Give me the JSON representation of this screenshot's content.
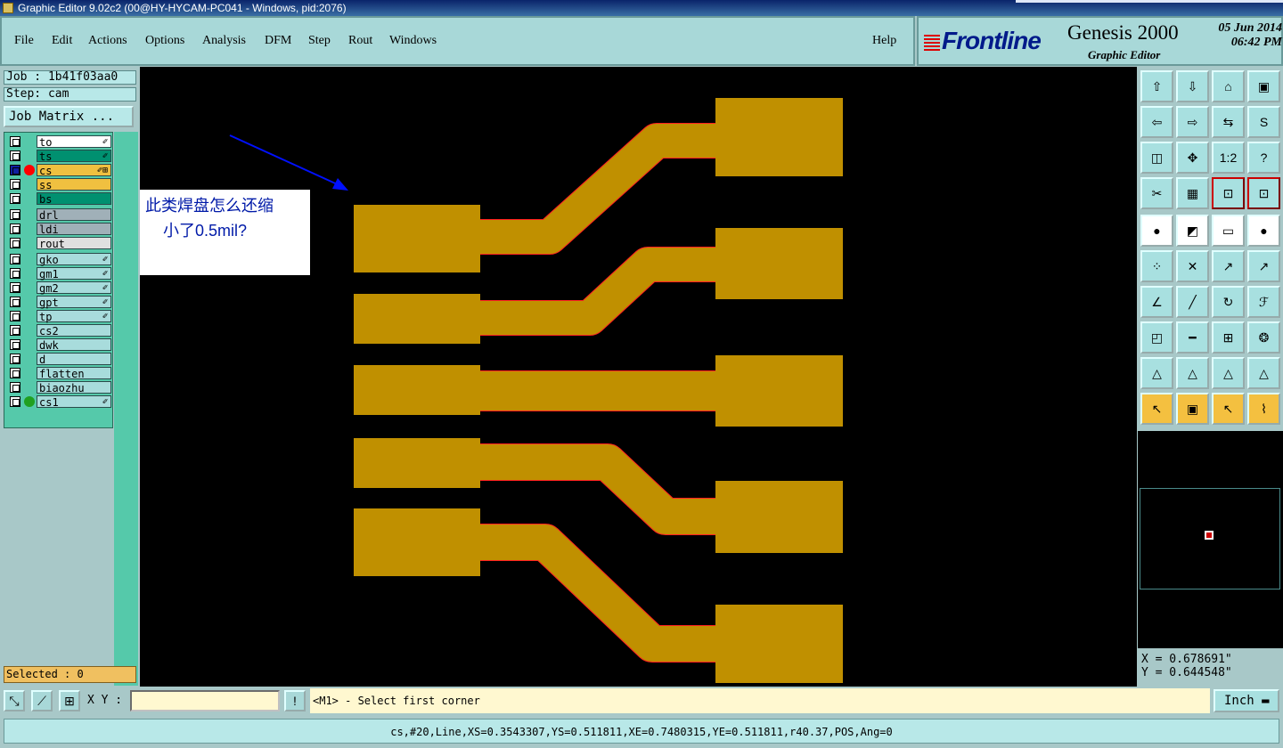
{
  "window": {
    "title": "Graphic Editor 9.02c2 (00@HY-HYCAM-PC041 - Windows, pid:2076)"
  },
  "menu": {
    "items": [
      "File",
      "Edit",
      "Actions",
      "Options",
      "Analysis",
      "DFM",
      "Step",
      "Rout",
      "Windows"
    ],
    "help": "Help"
  },
  "brand": {
    "logo": "Frontline",
    "product": "Genesis 2000",
    "subtitle": "Graphic Editor",
    "date": "05 Jun 2014",
    "time": "06:42 PM"
  },
  "job": {
    "job_label": "Job : 1b41f03aa0",
    "step_label": "Step: cam",
    "matrix_button": "Job Matrix ..."
  },
  "layers": [
    {
      "name": "to",
      "color": "#ffffff",
      "dot": "",
      "mark": "✐"
    },
    {
      "name": "ts",
      "color": "#009070",
      "dot": "",
      "mark": "✐"
    },
    {
      "name": "cs",
      "color": "#f0c040",
      "dot": "#ff0000",
      "mark": "✐⊞",
      "active": true
    },
    {
      "name": "ss",
      "color": "#f0c040",
      "dot": "",
      "mark": ""
    },
    {
      "name": "bs",
      "color": "#009070",
      "dot": "",
      "mark": ""
    },
    {
      "name": "drl",
      "color": "#a0b0b8",
      "dot": "",
      "mark": ""
    },
    {
      "name": "ldi",
      "color": "#a0b0b8",
      "dot": "",
      "mark": ""
    },
    {
      "name": "rout",
      "color": "#e0e0e0",
      "dot": "",
      "mark": ""
    },
    {
      "name": "gko",
      "color": "#a8dcdc",
      "dot": "",
      "mark": "✐"
    },
    {
      "name": "gm1",
      "color": "#a8dcdc",
      "dot": "",
      "mark": "✐"
    },
    {
      "name": "gm2",
      "color": "#a8dcdc",
      "dot": "",
      "mark": "✐"
    },
    {
      "name": "gpt",
      "color": "#a8dcdc",
      "dot": "",
      "mark": "✐"
    },
    {
      "name": "tp",
      "color": "#a8dcdc",
      "dot": "",
      "mark": "✐"
    },
    {
      "name": "cs2",
      "color": "#a8dcdc",
      "dot": "",
      "mark": ""
    },
    {
      "name": "dwk",
      "color": "#a8dcdc",
      "dot": "",
      "mark": ""
    },
    {
      "name": "d",
      "color": "#a8dcdc",
      "dot": "",
      "mark": ""
    },
    {
      "name": "flatten",
      "color": "#a8dcdc",
      "dot": "",
      "mark": ""
    },
    {
      "name": "biaozhu",
      "color": "#a8dcdc",
      "dot": "",
      "mark": ""
    },
    {
      "name": "cs1",
      "color": "#a8dcdc",
      "dot": "#20a020",
      "mark": "✐"
    }
  ],
  "selected": "Selected : 0",
  "annotation": {
    "line1": "此类焊盘怎么还缩",
    "line2": "小了0.5mil?"
  },
  "colors": {
    "copper": "#c09000",
    "outline": "#ff2020",
    "arrow": "#0010ff"
  },
  "toolbar_icons": [
    "open-icon",
    "save-icon",
    "home-icon",
    "window-icon",
    "back-icon",
    "forward-icon",
    "swap-icon",
    "route-icon",
    "zoom-fit-icon",
    "center-icon",
    "scale-icon",
    "help-icon",
    "measure-icon",
    "grid-icon",
    "snap-icon",
    "snap2-icon",
    "pad-icon",
    "outline-icon",
    "ruler-icon",
    "fill-icon",
    "node-icon",
    "cross-icon",
    "arrow-point-icon",
    "arrow-point2-icon",
    "angle-icon",
    "line-icon",
    "arc-icon",
    "text-icon",
    "pad-select-icon",
    "dash-icon",
    "dimension-icon",
    "group-icon",
    "triangle-icon",
    "triangle2-icon",
    "triangle3-icon",
    "triangle4-icon",
    "pointer-icon",
    "select-box-icon",
    "select-pointer-icon",
    "connect-icon"
  ],
  "toolbar_glyphs": [
    "⇧",
    "⇩",
    "⌂",
    "▣",
    "⇦",
    "⇨",
    "⇆",
    "S",
    "◫",
    "✥",
    "1:2",
    "?",
    "✂",
    "▦",
    "⊡",
    "⊡",
    "●",
    "◩",
    "▭",
    "●",
    "⁘",
    "✕",
    "↗",
    "↗",
    "∠",
    "╱",
    "↻",
    "ℱ",
    "◰",
    "━",
    "⊞",
    "❂",
    "△",
    "△",
    "△",
    "△",
    "↖",
    "▣",
    "↖",
    "⌇"
  ],
  "toolbar_styles": [
    "n",
    "n",
    "n",
    "n",
    "n",
    "n",
    "n",
    "n",
    "n",
    "n",
    "n",
    "n",
    "n",
    "n",
    "r",
    "r",
    "w",
    "w",
    "w",
    "w",
    "n",
    "n",
    "n",
    "n",
    "n",
    "n",
    "n",
    "n",
    "n",
    "n",
    "n",
    "n",
    "n",
    "n",
    "n",
    "n",
    "o",
    "o",
    "o",
    "o"
  ],
  "coords": {
    "x": "X = 0.678691\"",
    "y": "Y = 0.644548\""
  },
  "bottom": {
    "xy_label": "X Y :",
    "xy_value": "",
    "info_glyph": "!",
    "message": "<M1> - Select first corner",
    "units": "Inch"
  },
  "status": "cs,#20,Line,XS=0.3543307,YS=0.511811,XE=0.7480315,YE=0.511811,r40.37,POS,Ang=0"
}
